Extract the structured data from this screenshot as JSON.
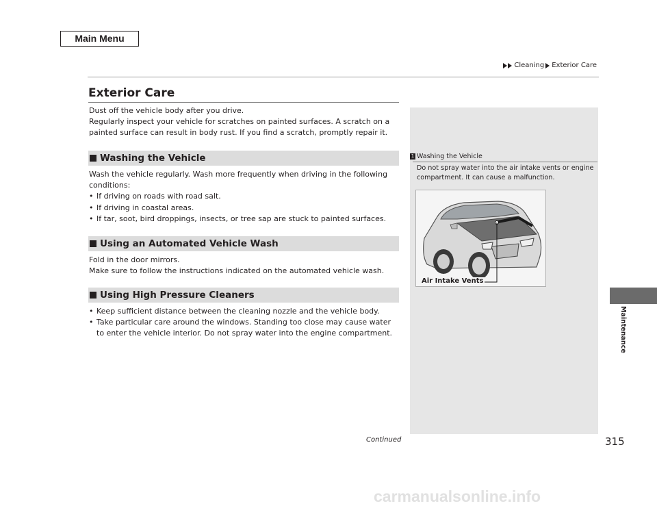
{
  "nav": {
    "main_menu_label": "Main Menu"
  },
  "breadcrumb": {
    "items": [
      "Cleaning",
      "Exterior Care"
    ]
  },
  "page": {
    "title": "Exterior Care",
    "number": "315",
    "continued": "Continued",
    "side_tab_label": "Maintenance"
  },
  "intro": {
    "line1": "Dust off the vehicle body after you drive.",
    "line2": "Regularly inspect your vehicle for scratches on painted surfaces. A scratch on a painted surface can result in body rust. If you find a scratch, promptly repair it."
  },
  "sections": [
    {
      "heading": "Washing the Vehicle",
      "text": "Wash the vehicle regularly. Wash more frequently when driving in the following conditions:",
      "bullets": [
        "If driving on roads with road salt.",
        "If driving in coastal areas.",
        "If tar, soot, bird droppings, insects, or tree sap are stuck to painted surfaces."
      ]
    },
    {
      "heading": "Using an Automated Vehicle Wash",
      "line1": "Fold in the door mirrors.",
      "line2": "Make sure to follow the instructions indicated on the automated vehicle wash."
    },
    {
      "heading": "Using High Pressure Cleaners",
      "bullets": [
        "Keep sufficient distance between the cleaning nozzle and the vehicle body.",
        "Take particular care around the windows. Standing too close may cause water to enter the vehicle interior. Do not spray water into the engine compartment."
      ]
    }
  ],
  "side_note": {
    "number": "1",
    "title": "Washing the Vehicle",
    "text": "Do not spray water into the air intake vents or engine compartment. It can cause a malfunction.",
    "callout": "Air Intake Vents"
  },
  "watermark": "carmanualsonline.info",
  "colors": {
    "heading_band": "#dcdcdc",
    "side_panel": "#e6e6e6",
    "tab": "#6b6b6b",
    "text": "#231f20"
  }
}
